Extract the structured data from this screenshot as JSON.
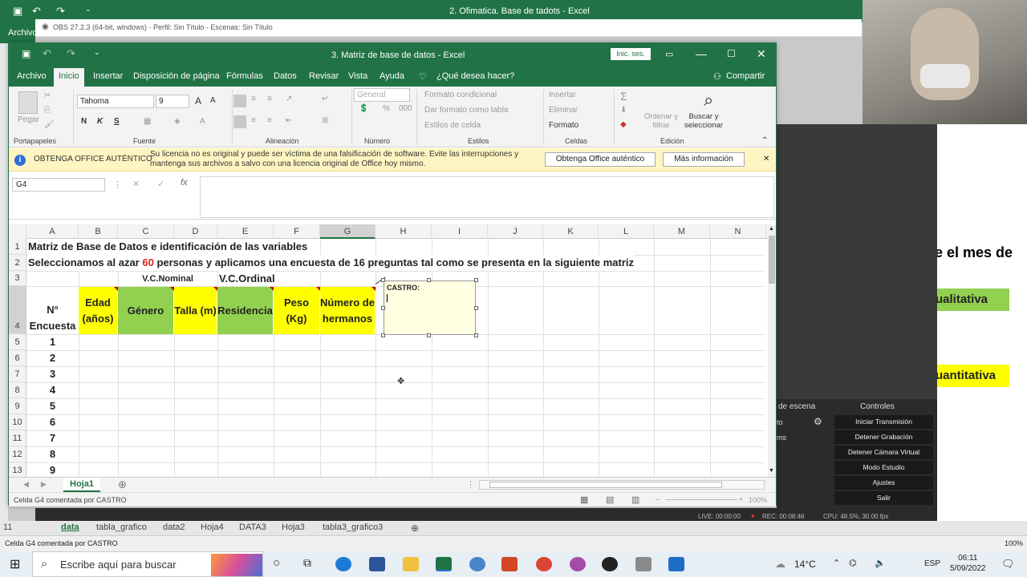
{
  "background_excel": {
    "title": "2. Ofimatica. Base de tadots  -  Excel",
    "archivo_label": "Archivo",
    "right_text1": "e el mes de",
    "right_label_cualitativa": "ualitativa",
    "right_label_cuantitativa": "uantitativa",
    "row_number": "11",
    "sheet_tabs": [
      "data",
      "tabla_grafico",
      "data2",
      "Hoja4",
      "DATA3",
      "Hoja3",
      "tabla3_grafico3"
    ],
    "status_text": "Celda G4 comentada por CASTRO",
    "zoom": "100%"
  },
  "obs": {
    "titlebar": "OBS 27.2.3 (64-bit, windows) - Perfil: Sin Título - Escenas: Sin Título",
    "panel_scene": "de escena",
    "panel_controls": "Controles",
    "buttons": [
      "Iniciar Transmisión",
      "Detener Grabación",
      "Detener Cámara Virtual",
      "Modo Estudio",
      "Ajustes",
      "Salir"
    ],
    "misc_to": "to",
    "misc_ms": "ms",
    "live": "LIVE: 00:00:00",
    "rec": "REC: 00:08:46",
    "cpu": "CPU: 48.5%, 30.00 fps"
  },
  "window": {
    "title": "3. Matriz de base de datos  -  Excel",
    "login_button": "Inic. ses.",
    "menu": [
      "Archivo",
      "Inicio",
      "Insertar",
      "Disposición de página",
      "Fórmulas",
      "Datos",
      "Revisar",
      "Vista",
      "Ayuda"
    ],
    "tell_me": "¿Qué desea hacer?",
    "share": "Compartir",
    "ribbon": {
      "pegar": "Pegar",
      "font_name": "Tahoma",
      "font_size": "9",
      "bold": "N",
      "italic": "K",
      "underline": "S",
      "number_format": "General",
      "formato_condicional": "Formato condicional",
      "dar_formato_tabla": "Dar formato como tabla",
      "estilos_celda": "Estilos de celda",
      "insertar": "Insertar",
      "eliminar": "Eliminar",
      "formato": "Formato",
      "ordenar": "Ordenar y filtrar",
      "buscar": "Buscar y seleccionar",
      "groups": [
        "Portapapeles",
        "Fuente",
        "Alineación",
        "Número",
        "Estilos",
        "Celdas",
        "Edición"
      ]
    },
    "warning": {
      "bold": "OBTENGA OFFICE AUTÉNTICO",
      "message": "Su licencia no es original y puede ser víctima de una falsificación de software. Evite las interrupciones y mantenga sus archivos a salvo con una licencia original de Office hoy mismo.",
      "btn1": "Obtenga Office auténtico",
      "btn2": "Más información"
    },
    "name_box": "G4",
    "columns": [
      "A",
      "B",
      "C",
      "D",
      "E",
      "F",
      "G",
      "H",
      "I",
      "J",
      "K",
      "L",
      "M",
      "N"
    ],
    "rows": [
      "1",
      "2",
      "3",
      "4",
      "5",
      "6",
      "7",
      "8",
      "9",
      "10",
      "11",
      "12",
      "13"
    ],
    "cells": {
      "r1": "Matriz de Base de Datos e identificación de las variables",
      "r2_pre": "Seleccionamos al azar ",
      "r2_num": "60",
      "r2_post": " personas y aplicamos una encuesta de 16 preguntas tal como se presenta en la siguiente matriz",
      "vc_nominal": "V.C.Nominal",
      "vc_ordinal": "V.C.Ordinal",
      "h_encuesta": "N° Encuesta",
      "h_edad": "Edad (años)",
      "h_genero": "Género",
      "h_talla": "Talla (m)",
      "h_residencia": "Residencia",
      "h_peso": "Peso (Kg)",
      "h_hermanos": "Número de hermanos",
      "encuestas": [
        "1",
        "2",
        "3",
        "4",
        "5",
        "6",
        "7",
        "8",
        "9"
      ]
    },
    "comment_author": "CASTRO:",
    "sheet_tab": "Hoja1",
    "status": "Celda G4 comentada por CASTRO",
    "zoom": "100%"
  },
  "taskbar": {
    "search_placeholder": "Escribe aquí para buscar",
    "temperature": "14°C",
    "language": "ESP",
    "time": "06:11",
    "date": "5/09/2022"
  },
  "colors": {
    "excel_green": "#217346",
    "yellow": "#ffff00",
    "green_fill": "#92d050",
    "red_num": "#e02020"
  }
}
